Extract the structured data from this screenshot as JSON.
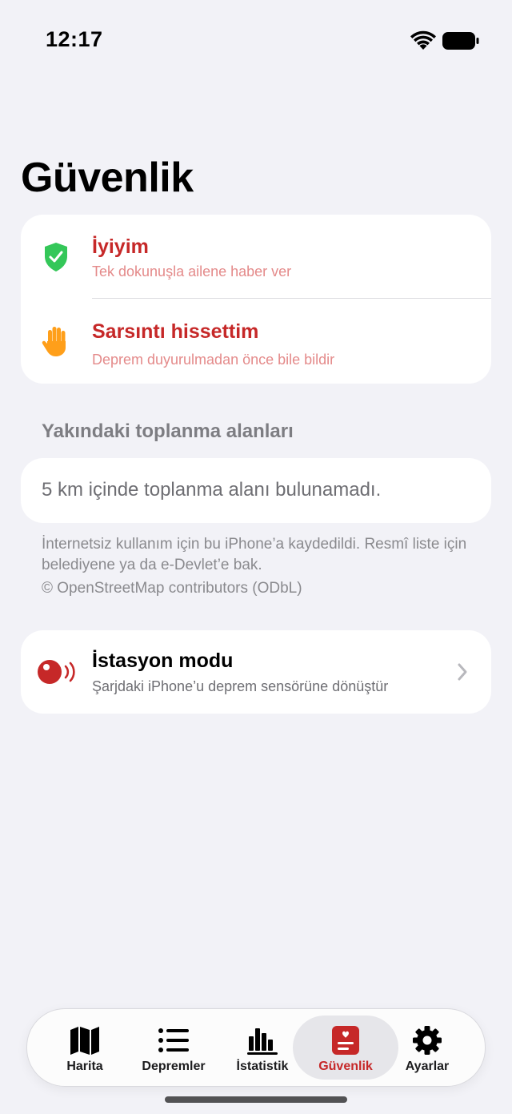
{
  "status_bar": {
    "time": "12:17",
    "icons": [
      "wifi-icon",
      "battery-icon"
    ]
  },
  "page": {
    "title": "Güvenlik"
  },
  "actions": [
    {
      "icon": "shield-check-icon",
      "title": "İyiyim",
      "subtitle": "Tek dokunuşla ailene haber ver"
    },
    {
      "icon": "raised-hand-icon",
      "title": "Sarsıntı hissettim",
      "subtitle": "Deprem duyurulmadan önce bile bildir"
    }
  ],
  "assembly": {
    "header": "Yakındaki toplanma alanları",
    "empty_text": "5 km içinde toplanma alanı bulunamadı.",
    "footnote": "İnternetsiz kullanım için bu iPhone’a kaydedildi. Resmî liste için belediyene ya da e-Devlet’e bak.",
    "attribution": "© OpenStreetMap contributors (ODbL)"
  },
  "station": {
    "icon": "seismic-sensor-icon",
    "title": "İstasyon modu",
    "subtitle": "Şarjdaki iPhone’u deprem sensörüne dönüştür"
  },
  "tabs": [
    {
      "label": "Harita",
      "icon": "map-icon",
      "active": false
    },
    {
      "label": "Depremler",
      "icon": "list-icon",
      "active": false
    },
    {
      "label": "İstatistik",
      "icon": "bar-chart-icon",
      "active": false
    },
    {
      "label": "Güvenlik",
      "icon": "heart-document-icon",
      "active": true
    },
    {
      "label": "Ayarlar",
      "icon": "gear-icon",
      "active": false
    }
  ],
  "colors": {
    "accent": "#c62828",
    "accent_light": "#e48a8a",
    "shield_green": "#34c759",
    "hand_orange": "#ff9f1a",
    "background": "#f2f2f7"
  }
}
